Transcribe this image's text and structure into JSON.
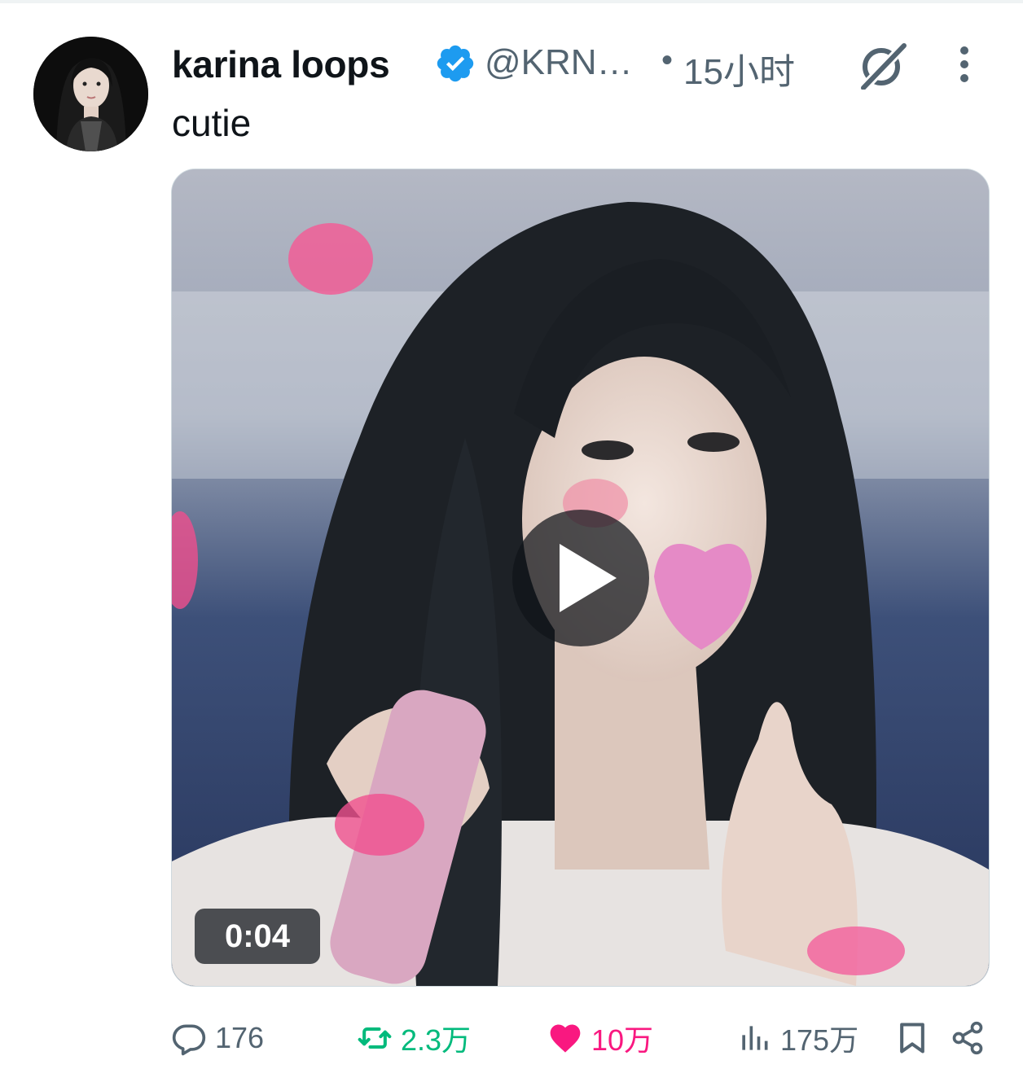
{
  "tweet": {
    "author_name": "karina loops",
    "handle": "@KRN…",
    "separator": "•",
    "time": "15小时",
    "text": "cutie"
  },
  "media": {
    "duration": "0:04"
  },
  "actions": {
    "replies": "176",
    "retweets": "2.3万",
    "likes": "10万",
    "views": "175万"
  },
  "colors": {
    "verified": "#1d9bf0",
    "retweet": "#00ba7c",
    "like": "#f91880",
    "muted": "#536471"
  },
  "icons": [
    "verified-badge-icon",
    "grok-icon",
    "more-icon",
    "play-icon",
    "reply-icon",
    "retweet-icon",
    "heart-icon",
    "views-icon",
    "bookmark-icon",
    "share-icon"
  ]
}
